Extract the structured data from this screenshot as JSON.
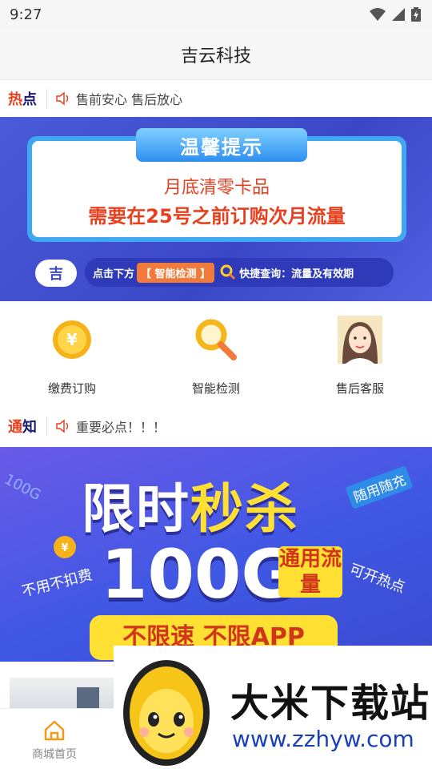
{
  "status": {
    "time": "9:27"
  },
  "header": {
    "title": "吉云科技"
  },
  "hot_notice": {
    "tag_a": "热",
    "tag_b": "点",
    "text": "售前安心 售后放心"
  },
  "banner_tip": {
    "heading": "温馨提示",
    "line1": "月底清零卡品",
    "line2": "需要在25号之前订购次月流量",
    "cloud": "吉",
    "hint_pre": "点击下方",
    "hint_highlight": "【 智能检测 】",
    "hint_post": "快捷查询：流量及有效期"
  },
  "shortcuts": [
    {
      "label": "缴费订购",
      "icon": "coin-yen-icon"
    },
    {
      "label": "智能检测",
      "icon": "magnifier-icon"
    },
    {
      "label": "售后客服",
      "icon": "service-avatar-icon"
    }
  ],
  "notice2": {
    "tag_a": "通",
    "tag_b": "知",
    "text": "重要必点！！！"
  },
  "promo": {
    "side_100g": "100G",
    "main_white": "限时",
    "main_yellow": "秒杀",
    "corner": "随用随充",
    "big": "100G",
    "tag": "通用流量",
    "left": "不用不扣费",
    "right": "可开热点",
    "bottom": "不限速 不限APP"
  },
  "tabbar": {
    "home_label": "商城首页"
  },
  "watermark": {
    "title": "大米下载站",
    "url": "www.zzhyw.com"
  },
  "colors": {
    "accent_red": "#e8401f",
    "banner_blue": "#3a48c8",
    "yellow": "#ffe033"
  }
}
